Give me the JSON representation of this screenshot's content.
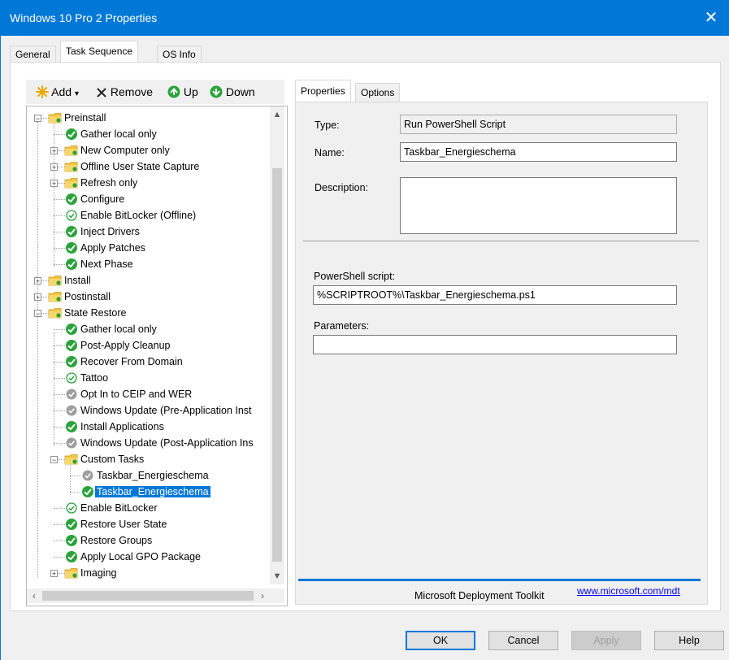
{
  "window": {
    "title": "Windows 10 Pro 2 Properties",
    "close_glyph": "✕"
  },
  "tabs": [
    {
      "label": "General"
    },
    {
      "label": "Task Sequence"
    },
    {
      "label": "OS Info"
    }
  ],
  "toolbar": {
    "add_label": "Add",
    "add_caret": "▾",
    "remove_label": "Remove",
    "up_label": "Up",
    "down_label": "Down"
  },
  "tree": [
    {
      "label": "Preinstall",
      "icon": "folder-icon",
      "expander": "−"
    },
    {
      "label": "Gather local only",
      "icon": "check-success-icon"
    },
    {
      "label": "New Computer only",
      "icon": "folder-icon",
      "expander": "+"
    },
    {
      "label": "Offline User State Capture",
      "icon": "folder-icon",
      "expander": "+"
    },
    {
      "label": "Refresh only",
      "icon": "folder-icon",
      "expander": "+"
    },
    {
      "label": "Configure",
      "icon": "check-success-icon"
    },
    {
      "label": "Enable BitLocker (Offline)",
      "icon": "check-outline-icon"
    },
    {
      "label": "Inject Drivers",
      "icon": "check-success-icon"
    },
    {
      "label": "Apply Patches",
      "icon": "check-success-icon"
    },
    {
      "label": "Next Phase",
      "icon": "check-success-icon"
    },
    {
      "label": "Install",
      "icon": "folder-icon",
      "expander": "+"
    },
    {
      "label": "Postinstall",
      "icon": "folder-icon",
      "expander": "+"
    },
    {
      "label": "State Restore",
      "icon": "folder-icon",
      "expander": "−"
    },
    {
      "label": "Gather local only",
      "icon": "check-success-icon"
    },
    {
      "label": "Post-Apply Cleanup",
      "icon": "check-success-icon"
    },
    {
      "label": "Recover From Domain",
      "icon": "check-success-icon"
    },
    {
      "label": "Tattoo",
      "icon": "check-outline-icon"
    },
    {
      "label": "Opt In to CEIP and WER",
      "icon": "check-disabled-icon"
    },
    {
      "label": "Windows Update (Pre-Application Inst",
      "icon": "check-disabled-icon"
    },
    {
      "label": "Install Applications",
      "icon": "check-success-icon"
    },
    {
      "label": "Windows Update (Post-Application Ins",
      "icon": "check-disabled-icon"
    },
    {
      "label": "Custom Tasks",
      "icon": "folder-icon",
      "expander": "−"
    },
    {
      "label": "Taskbar_Energieschema",
      "icon": "check-disabled-icon"
    },
    {
      "label": "Taskbar_Energieschema",
      "icon": "check-success-icon",
      "selected": true
    },
    {
      "label": "Enable BitLocker",
      "icon": "check-outline-icon"
    },
    {
      "label": "Restore User State",
      "icon": "check-success-icon"
    },
    {
      "label": "Restore Groups",
      "icon": "check-success-icon"
    },
    {
      "label": "Apply Local GPO Package",
      "icon": "check-success-icon"
    },
    {
      "label": "Imaging",
      "icon": "folder-icon",
      "expander": "+"
    }
  ],
  "scroll": {
    "up": "▲",
    "down": "▼",
    "left": "‹",
    "right": "›"
  },
  "props_tabs": [
    {
      "label": "Properties"
    },
    {
      "label": "Options"
    }
  ],
  "props": {
    "type_label": "Type:",
    "type_value": "Run PowerShell Script",
    "name_label": "Name:",
    "name_value": "Taskbar_Energieschema",
    "description_label": "Description:",
    "description_value": "",
    "script_label": "PowerShell script:",
    "script_value": "%SCRIPTROOT%\\Taskbar_Energieschema.ps1",
    "params_label": "Parameters:",
    "params_value": ""
  },
  "footer": {
    "text": "Microsoft Deployment Toolkit",
    "link": "www.microsoft.com/mdt"
  },
  "buttons": {
    "ok": "OK",
    "cancel": "Cancel",
    "apply": "Apply",
    "help": "Help"
  },
  "colors": {
    "accent": "#0078d7",
    "success_green": "#2aa33b",
    "disabled_gray": "#9e9e9e",
    "folder_yellow": "#f2c641"
  }
}
